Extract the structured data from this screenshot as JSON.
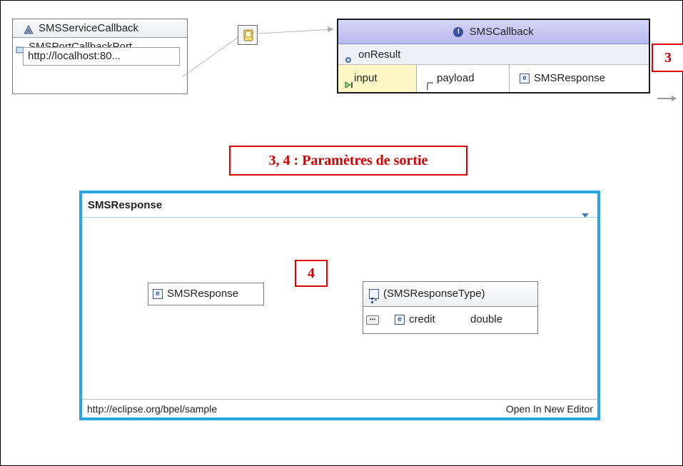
{
  "service": {
    "name": "SMSServiceCallback",
    "port": "SMSPortCallbackPort",
    "url": "http://localhost:80..."
  },
  "callback": {
    "title": "SMSCallback",
    "operation": "onResult",
    "input_label": "input",
    "part_label": "payload",
    "element_label": "SMSResponse"
  },
  "annotations": {
    "badge_3": "3",
    "output_params": "3, 4 : Paramètres de sortie",
    "badge_4": "4"
  },
  "schema_panel": {
    "title": "SMSResponse",
    "element_name": "SMSResponse",
    "type_name": "(SMSResponseType)",
    "child_name": "credit",
    "child_type": "double",
    "namespace": "http://eclipse.org/bpel/sample",
    "open_link": "Open In New Editor"
  },
  "colors": {
    "annotation_red": "#e00000",
    "panel_border": "#2aa5e0",
    "callback_header": "#c7c8f3",
    "input_cell": "#fff7c8"
  }
}
